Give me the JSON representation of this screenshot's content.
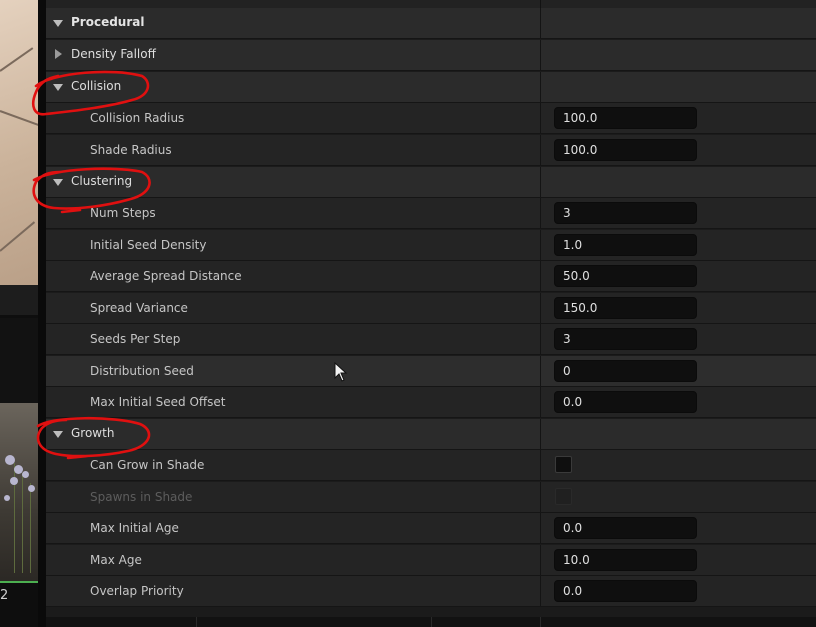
{
  "panel": {
    "sections": [
      {
        "id": "procedural",
        "label": "Procedural",
        "expanded": true,
        "level": 0
      },
      {
        "id": "density-falloff",
        "label": "Density Falloff",
        "expanded": false,
        "level": 1
      },
      {
        "id": "collision",
        "label": "Collision",
        "expanded": true,
        "level": 1
      },
      {
        "id": "clustering",
        "label": "Clustering",
        "expanded": true,
        "level": 1
      },
      {
        "id": "growth",
        "label": "Growth",
        "expanded": true,
        "level": 1
      }
    ],
    "collision": {
      "collision_radius": {
        "label": "Collision Radius",
        "value": "100.0"
      },
      "shade_radius": {
        "label": "Shade Radius",
        "value": "100.0"
      }
    },
    "clustering": {
      "num_steps": {
        "label": "Num Steps",
        "value": "3"
      },
      "initial_seed_density": {
        "label": "Initial Seed Density",
        "value": "1.0"
      },
      "average_spread_distance": {
        "label": "Average Spread Distance",
        "value": "50.0"
      },
      "spread_variance": {
        "label": "Spread Variance",
        "value": "150.0"
      },
      "seeds_per_step": {
        "label": "Seeds Per Step",
        "value": "3"
      },
      "distribution_seed": {
        "label": "Distribution Seed",
        "value": "0"
      },
      "max_initial_seed_offset": {
        "label": "Max Initial Seed Offset",
        "value": "0.0"
      }
    },
    "growth": {
      "can_grow_in_shade": {
        "label": "Can Grow in Shade",
        "checked": false
      },
      "spawns_in_shade": {
        "label": "Spawns in Shade",
        "checked": false,
        "disabled": true
      },
      "max_initial_age": {
        "label": "Max Initial Age",
        "value": "0.0"
      },
      "max_age": {
        "label": "Max Age",
        "value": "10.0"
      },
      "overlap_priority": {
        "label": "Overlap Priority",
        "value": "0.0"
      }
    }
  },
  "viewport": {
    "counter_text": "2"
  },
  "colors": {
    "panel_bg": "#1b1b1b",
    "header_row": "#2b2b2b",
    "prop_row": "#242424",
    "input_bg": "#0f0f0f",
    "annotation": "#e01010"
  },
  "icons": {
    "expanded": "triangle-down-icon",
    "collapsed": "triangle-right-icon",
    "cursor": "mouse-pointer-icon"
  }
}
